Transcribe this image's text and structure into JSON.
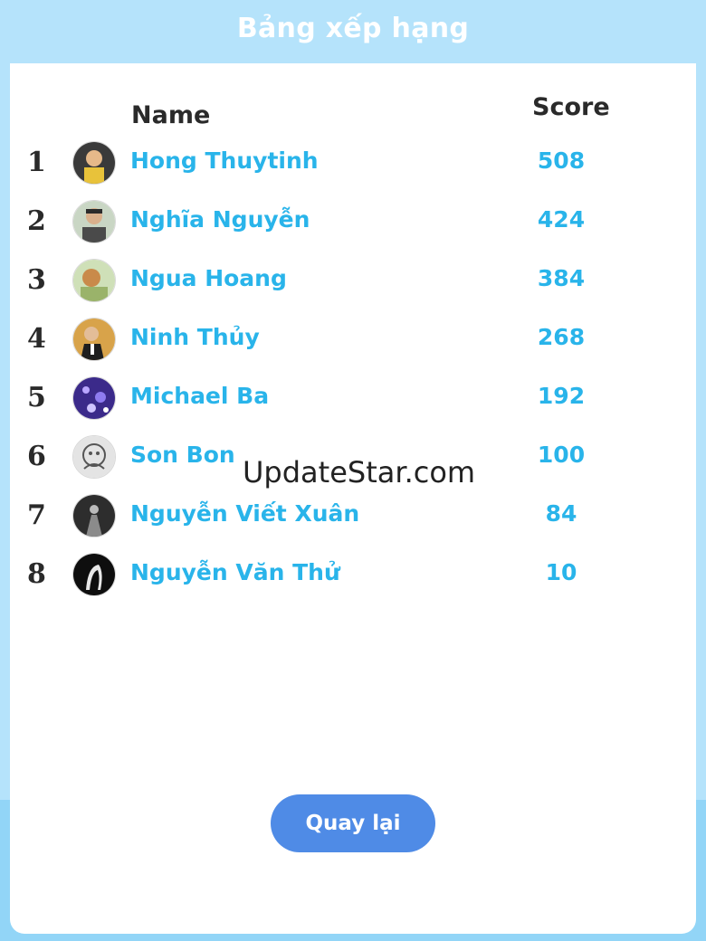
{
  "header": {
    "title": "Bảng xếp hạng"
  },
  "columns": {
    "name": "Name",
    "score": "Score"
  },
  "players": [
    {
      "rank": "1",
      "name": "Hong Thuytinh",
      "score": "508",
      "avatar": "user-avatar-icon"
    },
    {
      "rank": "2",
      "name": "Nghĩa Nguyễn",
      "score": "424",
      "avatar": "user-avatar-icon"
    },
    {
      "rank": "3",
      "name": "Ngua Hoang",
      "score": "384",
      "avatar": "user-avatar-icon"
    },
    {
      "rank": "4",
      "name": "Ninh Thủy",
      "score": "268",
      "avatar": "user-avatar-icon"
    },
    {
      "rank": "5",
      "name": "Michael Ba",
      "score": "192",
      "avatar": "user-avatar-icon"
    },
    {
      "rank": "6",
      "name": "Son Bon",
      "score": "100",
      "avatar": "user-avatar-icon"
    },
    {
      "rank": "7",
      "name": "Nguyễn Viết Xuân",
      "score": "84",
      "avatar": "user-avatar-icon"
    },
    {
      "rank": "8",
      "name": "Nguyễn Văn Thử",
      "score": "10",
      "avatar": "user-avatar-icon"
    }
  ],
  "watermark": "UpdateStar.com",
  "back_button": {
    "label": "Quay lại"
  },
  "colors": {
    "background": "#b5e3fb",
    "accent_text": "#29b4ea",
    "button": "#4f8be6",
    "panel": "#ffffff"
  }
}
